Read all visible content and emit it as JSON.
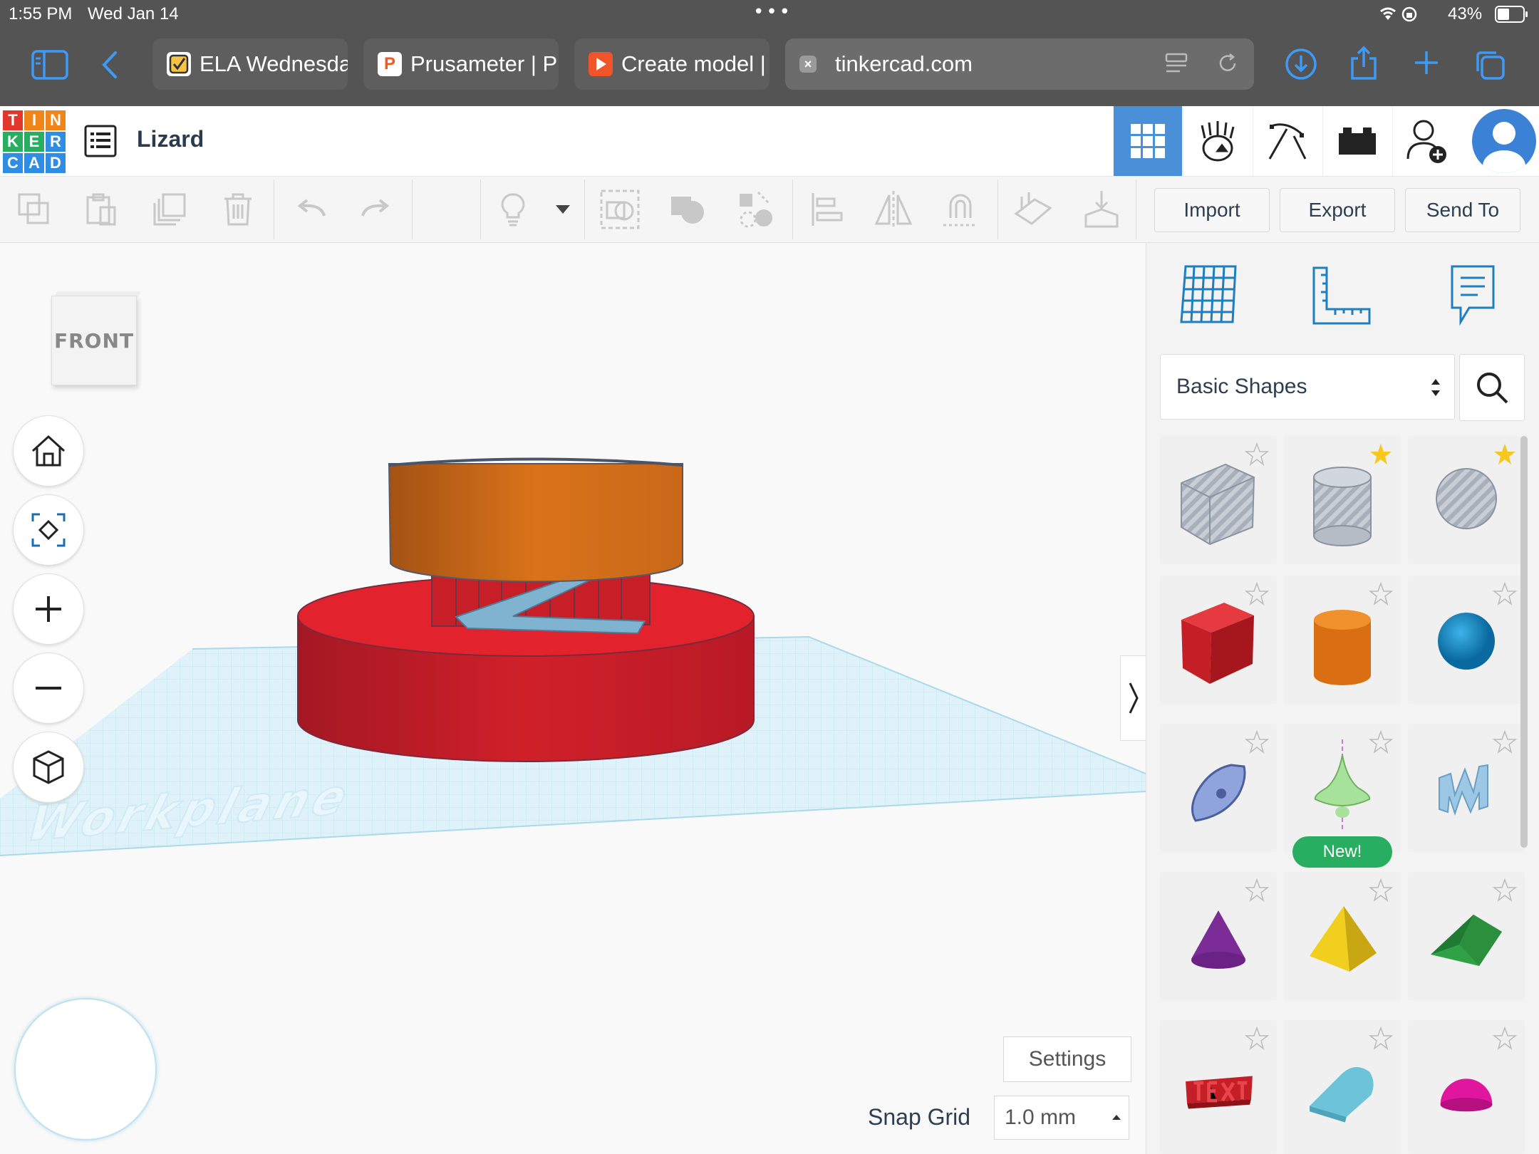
{
  "status": {
    "time": "1:55 PM",
    "date": "Wed Jan 14",
    "battery": "43%"
  },
  "browser": {
    "tabs": [
      {
        "label": "ELA Wednesda",
        "icon": "checkbox-icon"
      },
      {
        "label": "Prusameter | P",
        "icon": "p-icon"
      },
      {
        "label": "Create model |",
        "icon": "play-icon"
      }
    ],
    "url": "tinkercad.com"
  },
  "app": {
    "logo": [
      "T",
      "I",
      "N",
      "K",
      "E",
      "R",
      "C",
      "A",
      "D"
    ],
    "title": "Lizard"
  },
  "toolbar": {
    "import": "Import",
    "export": "Export",
    "send_to": "Send To"
  },
  "panel": {
    "library": "Basic Shapes",
    "new_badge": "New!"
  },
  "canvas": {
    "view_cube": "FRONT",
    "workplane": "Workplane"
  },
  "footer": {
    "settings": "Settings",
    "snap_label": "Snap Grid",
    "snap_value": "1.0 mm"
  },
  "colors": {
    "accent": "#2f8de4",
    "red": "#d0202a",
    "orange": "#d9731a",
    "workplane": "#dff2f9"
  }
}
